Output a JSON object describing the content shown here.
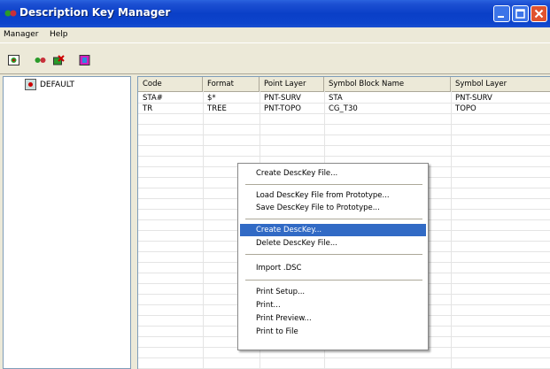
{
  "window": {
    "title": "Description Key Manager",
    "title_bar_color": "#0a3fc7",
    "close_color": "#e0532e"
  },
  "menubar": {
    "items": [
      {
        "label": "Manager"
      },
      {
        "label": "Help"
      }
    ]
  },
  "toolbar": {
    "buttons": [
      {
        "icon": "new-icon"
      },
      {
        "icon": "edit-icon"
      },
      {
        "icon": "delete-icon"
      },
      {
        "icon": "properties-icon"
      }
    ]
  },
  "tree": {
    "root_label": "DEFAULT"
  },
  "grid": {
    "columns": [
      "Code",
      "Format",
      "Point Layer",
      "Symbol Block Name",
      "Symbol Layer"
    ],
    "rows": [
      [
        "STA#",
        "$*",
        "PNT-SURV",
        "STA",
        "PNT-SURV"
      ],
      [
        "TR",
        "TREE",
        "PNT-TOPO",
        "CG_T30",
        "TOPO"
      ]
    ]
  },
  "context_menu": {
    "items": [
      "Create DescKey File...",
      "Load DescKey File from Prototype...",
      "Save DescKey File to Prototype...",
      "Create DescKey...",
      "Delete DescKey File...",
      "Import .DSC",
      "Print Setup...",
      "Print...",
      "Print Preview...",
      "Print to File"
    ],
    "highlighted": "Create DescKey...",
    "highlight_color": "#316ac5"
  }
}
